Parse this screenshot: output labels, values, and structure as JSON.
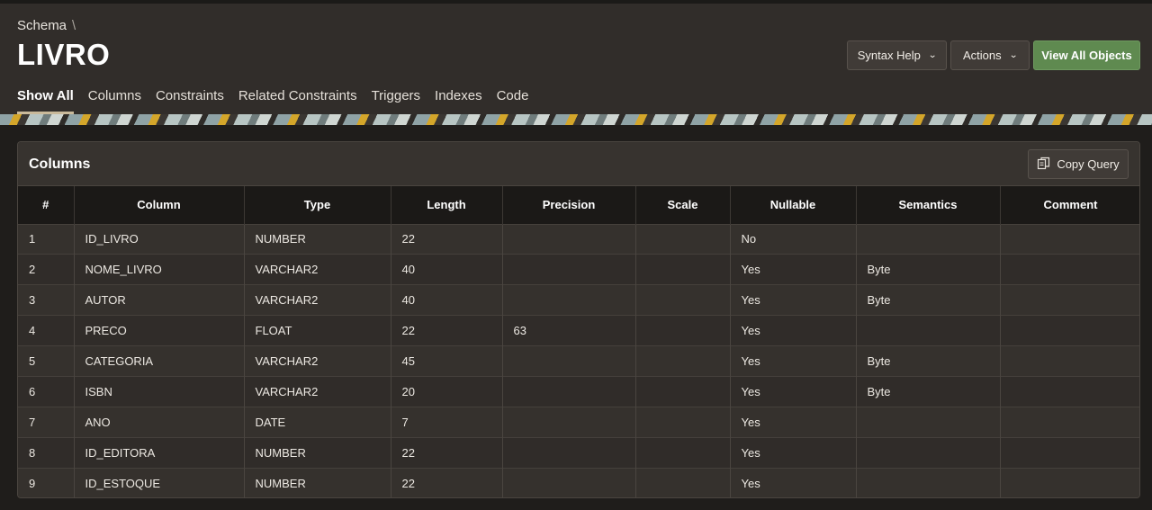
{
  "breadcrumb": {
    "label": "Schema",
    "separator": "\\"
  },
  "page_title": "LIVRO",
  "buttons": {
    "syntax_help": "Syntax Help",
    "actions": "Actions",
    "view_all": "View All Objects"
  },
  "tabs": [
    {
      "label": "Show All"
    },
    {
      "label": "Columns"
    },
    {
      "label": "Constraints"
    },
    {
      "label": "Related Constraints"
    },
    {
      "label": "Triggers"
    },
    {
      "label": "Indexes"
    },
    {
      "label": "Code"
    }
  ],
  "region": {
    "title": "Columns",
    "copy_label": "Copy Query"
  },
  "table": {
    "headers": [
      "#",
      "Column",
      "Type",
      "Length",
      "Precision",
      "Scale",
      "Nullable",
      "Semantics",
      "Comment"
    ],
    "rows": [
      [
        "1",
        "ID_LIVRO",
        "NUMBER",
        "22",
        "",
        "",
        "No",
        "",
        ""
      ],
      [
        "2",
        "NOME_LIVRO",
        "VARCHAR2",
        "40",
        "",
        "",
        "Yes",
        "Byte",
        ""
      ],
      [
        "3",
        "AUTOR",
        "VARCHAR2",
        "40",
        "",
        "",
        "Yes",
        "Byte",
        ""
      ],
      [
        "4",
        "PRECO",
        "FLOAT",
        "22",
        "63",
        "",
        "Yes",
        "",
        ""
      ],
      [
        "5",
        "CATEGORIA",
        "VARCHAR2",
        "45",
        "",
        "",
        "Yes",
        "Byte",
        ""
      ],
      [
        "6",
        "ISBN",
        "VARCHAR2",
        "20",
        "",
        "",
        "Yes",
        "Byte",
        ""
      ],
      [
        "7",
        "ANO",
        "DATE",
        "7",
        "",
        "",
        "Yes",
        "",
        ""
      ],
      [
        "8",
        "ID_EDITORA",
        "NUMBER",
        "22",
        "",
        "",
        "Yes",
        "",
        ""
      ],
      [
        "9",
        "ID_ESTOQUE",
        "NUMBER",
        "22",
        "",
        "",
        "Yes",
        "",
        ""
      ]
    ]
  },
  "icons": {
    "chevron": "chevron-down-icon",
    "copy": "copy-icon"
  },
  "colors": {
    "header_bg": "#312d2a",
    "primary_button": "#5f8a50",
    "active_tab_underline": "#c9b99a"
  }
}
